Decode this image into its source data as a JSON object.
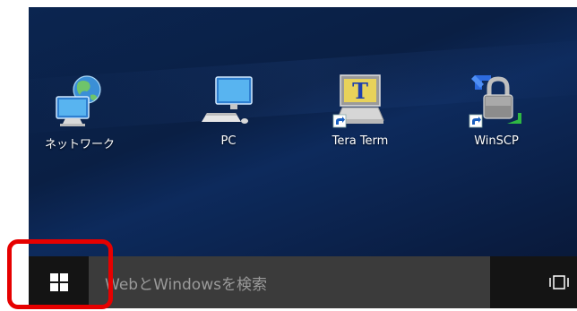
{
  "desktop": {
    "icons": [
      {
        "label": "ネットワーク",
        "icon": "network-icon"
      },
      {
        "label": "PC",
        "icon": "pc-icon"
      },
      {
        "label": "Tera Term",
        "icon": "tera-term-icon"
      },
      {
        "label": "WinSCP",
        "icon": "winscp-icon"
      }
    ],
    "shortcut_badge": "shortcut-arrow-icon"
  },
  "taskbar": {
    "start_icon": "windows-logo-icon",
    "search_placeholder": "WebとWindowsを検索",
    "task_view_icon": "task-view-icon"
  },
  "annotation": {
    "highlight_color": "#e60000"
  },
  "colors": {
    "desktop": "#0a1f44",
    "taskbar": "#141414",
    "search": "#3b3b3b"
  }
}
